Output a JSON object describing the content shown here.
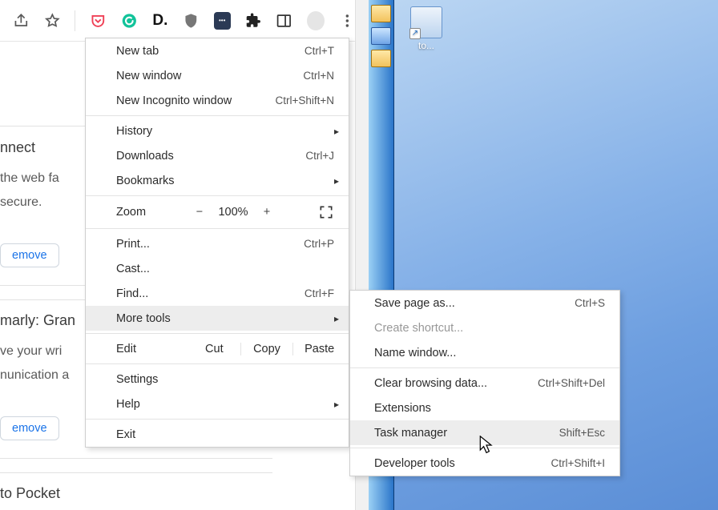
{
  "desktop": {
    "shortcut_label": "to..."
  },
  "toolbar": {
    "icons": [
      "share-icon",
      "star-icon",
      "pocket-icon",
      "grammarly-icon",
      "darkreader-d-icon",
      "ublock-icon",
      "bitwarden-icon",
      "extensions-puzzle-icon",
      "sidepanel-icon",
      "profile-avatar",
      "kebab-menu-icon"
    ]
  },
  "page": {
    "heading1": "nnect",
    "line1a": "the web fa",
    "line1b": "secure.",
    "btn_remove": "emove",
    "heading2": "marly: Gran",
    "line2a": "ve your wri",
    "line2b": "nunication a",
    "heading3": "to Pocket"
  },
  "menu": {
    "new_tab": {
      "label": "New tab",
      "sc": "Ctrl+T"
    },
    "new_window": {
      "label": "New window",
      "sc": "Ctrl+N"
    },
    "incognito": {
      "label": "New Incognito window",
      "sc": "Ctrl+Shift+N"
    },
    "history": {
      "label": "History"
    },
    "downloads": {
      "label": "Downloads",
      "sc": "Ctrl+J"
    },
    "bookmarks": {
      "label": "Bookmarks"
    },
    "zoom": {
      "label": "Zoom",
      "minus": "−",
      "pct": "100%",
      "plus": "+"
    },
    "print": {
      "label": "Print...",
      "sc": "Ctrl+P"
    },
    "cast": {
      "label": "Cast..."
    },
    "find": {
      "label": "Find...",
      "sc": "Ctrl+F"
    },
    "more_tools": {
      "label": "More tools"
    },
    "edit": {
      "label": "Edit",
      "cut": "Cut",
      "copy": "Copy",
      "paste": "Paste"
    },
    "settings": {
      "label": "Settings"
    },
    "help": {
      "label": "Help"
    },
    "exit": {
      "label": "Exit"
    }
  },
  "submenu": {
    "save_as": {
      "label": "Save page as...",
      "sc": "Ctrl+S"
    },
    "create_sc": {
      "label": "Create shortcut..."
    },
    "name_window": {
      "label": "Name window..."
    },
    "clear_data": {
      "label": "Clear browsing data...",
      "sc": "Ctrl+Shift+Del"
    },
    "extensions": {
      "label": "Extensions"
    },
    "task_mgr": {
      "label": "Task manager",
      "sc": "Shift+Esc"
    },
    "dev_tools": {
      "label": "Developer tools",
      "sc": "Ctrl+Shift+I"
    }
  }
}
